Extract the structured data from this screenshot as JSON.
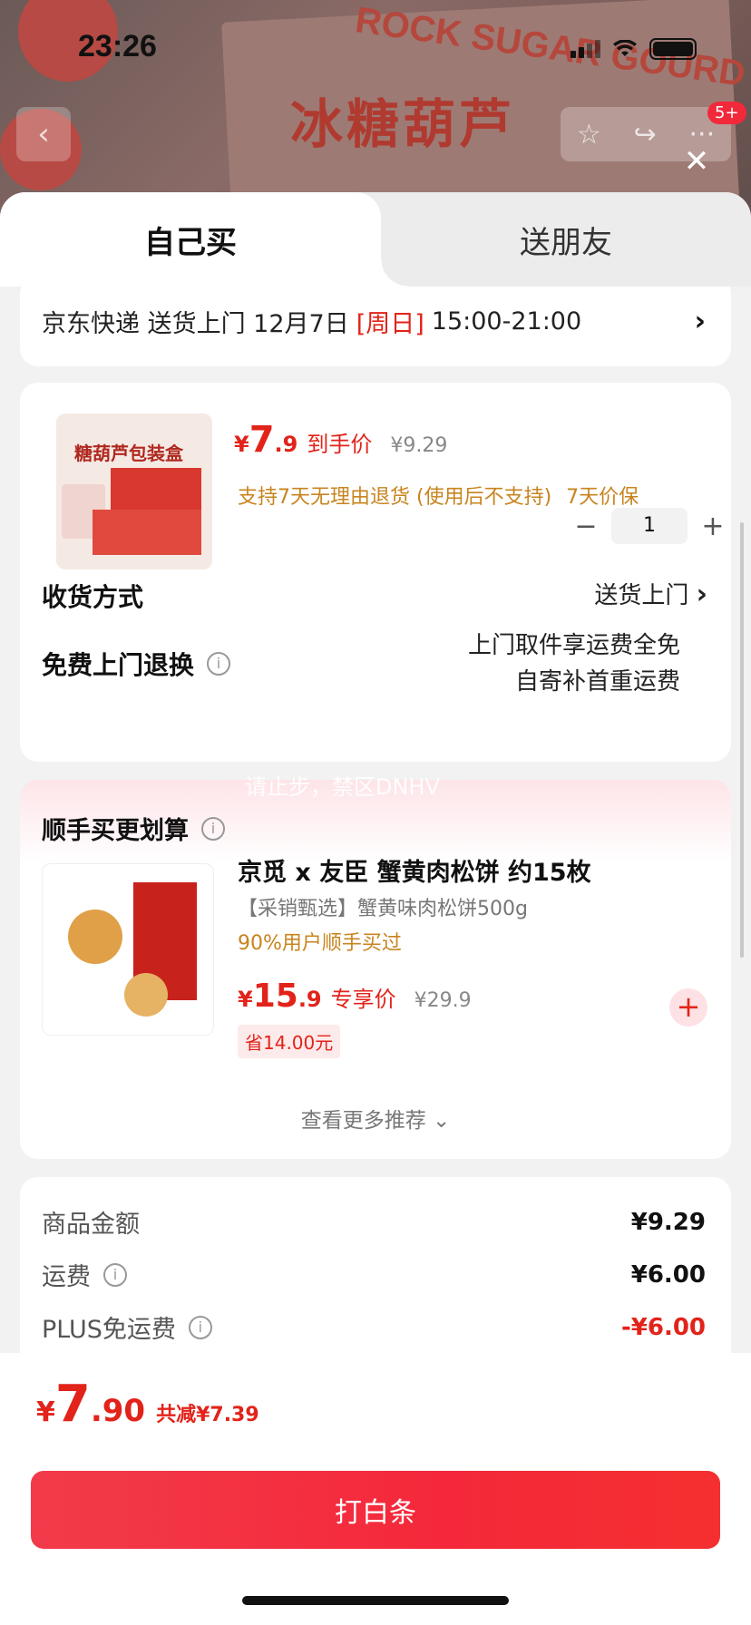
{
  "status_bar": {
    "time": "23:26"
  },
  "background": {
    "title_en": "ROCK SUGAR GOURD",
    "title_cn": "冰糖葫芦",
    "badge": "5+"
  },
  "tabs": [
    {
      "label": "自己买"
    },
    {
      "label": "送朋友"
    }
  ],
  "delivery": {
    "text_prefix": "京东快递 送货上门 12月7日",
    "weekday": "[周日]",
    "time_range": "15:00-21:00"
  },
  "product": {
    "image_text": "糖葫芦包装盒",
    "price_yen": "¥",
    "price_int": "7",
    "price_dec": ".9",
    "price_tag": "到手价",
    "original_price": "¥9.29",
    "return_policy": "支持7天无理由退货 (使用后不支持)",
    "price_protect": "7天价保",
    "quantity": "1",
    "minus": "−",
    "plus": "+"
  },
  "shipping": {
    "label": "收货方式",
    "value": "送货上门"
  },
  "free_return": {
    "label": "免费上门退换",
    "line1": "上门取件享运费全免",
    "line2": "自寄补首重运费"
  },
  "recommend": {
    "watermark": "请止步，禁区DNHV",
    "title": "顺手买更划算",
    "name": "京觅 x 友臣 蟹黄肉松饼 约15枚",
    "desc": "【采销甄选】蟹黄味肉松饼500g",
    "bought": "90%用户顺手买过",
    "price_yen": "¥",
    "price_int": "15",
    "price_dec": ".9",
    "price_tag": "专享价",
    "original_price": "¥29.9",
    "save": "省14.00元",
    "more": "查看更多推荐 ⌄"
  },
  "summary": {
    "rows": [
      {
        "label": "商品金额",
        "value": "¥9.29"
      },
      {
        "label": "运费",
        "value": "¥6.00"
      },
      {
        "label": "PLUS免运费",
        "value": "-¥6.00"
      }
    ]
  },
  "bottom": {
    "total_yen": "¥",
    "total_int": "7",
    "total_dec": ".90",
    "total_save": "共减¥7.39",
    "pay_button": "打白条"
  }
}
